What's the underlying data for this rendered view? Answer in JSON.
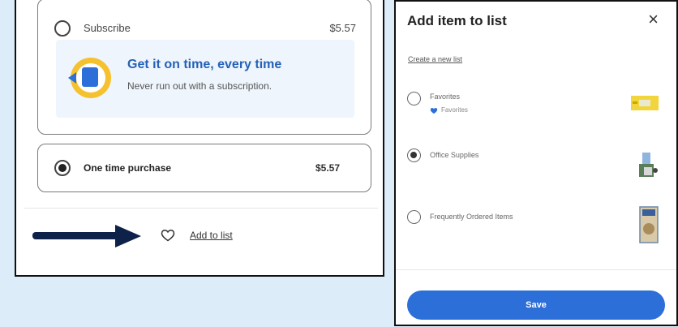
{
  "purchase": {
    "subscribe_label": "Subscribe",
    "subscribe_price": "$5.57",
    "promo_title": "Get it on time, every time",
    "promo_subtitle": "Never run out with a subscription.",
    "onetime_label": "One time purchase",
    "onetime_price": "$5.57",
    "selected_option": "one-time",
    "add_to_list_label": "Add to list"
  },
  "modal": {
    "title": "Add item to list",
    "close_glyph": "×",
    "create_list_label": "Create a new list",
    "lists": [
      {
        "name": "Favorites",
        "sublabel": "Favorites",
        "selected": false
      },
      {
        "name": "Office Supplies",
        "selected": true
      },
      {
        "name": "Frequently Ordered Items",
        "selected": false
      }
    ],
    "save_label": "Save"
  },
  "colors": {
    "page_bg": "#dcecf8",
    "accent_blue": "#2c6fd8",
    "promo_title": "#2561b8",
    "arrow": "#0d2149",
    "promo_bg": "#eef5fc"
  },
  "icons": {
    "heart": "heart-outline-icon",
    "close": "close-icon",
    "subscription": "subscription-calendar-icon",
    "annotation_arrow": "right-arrow-icon"
  }
}
